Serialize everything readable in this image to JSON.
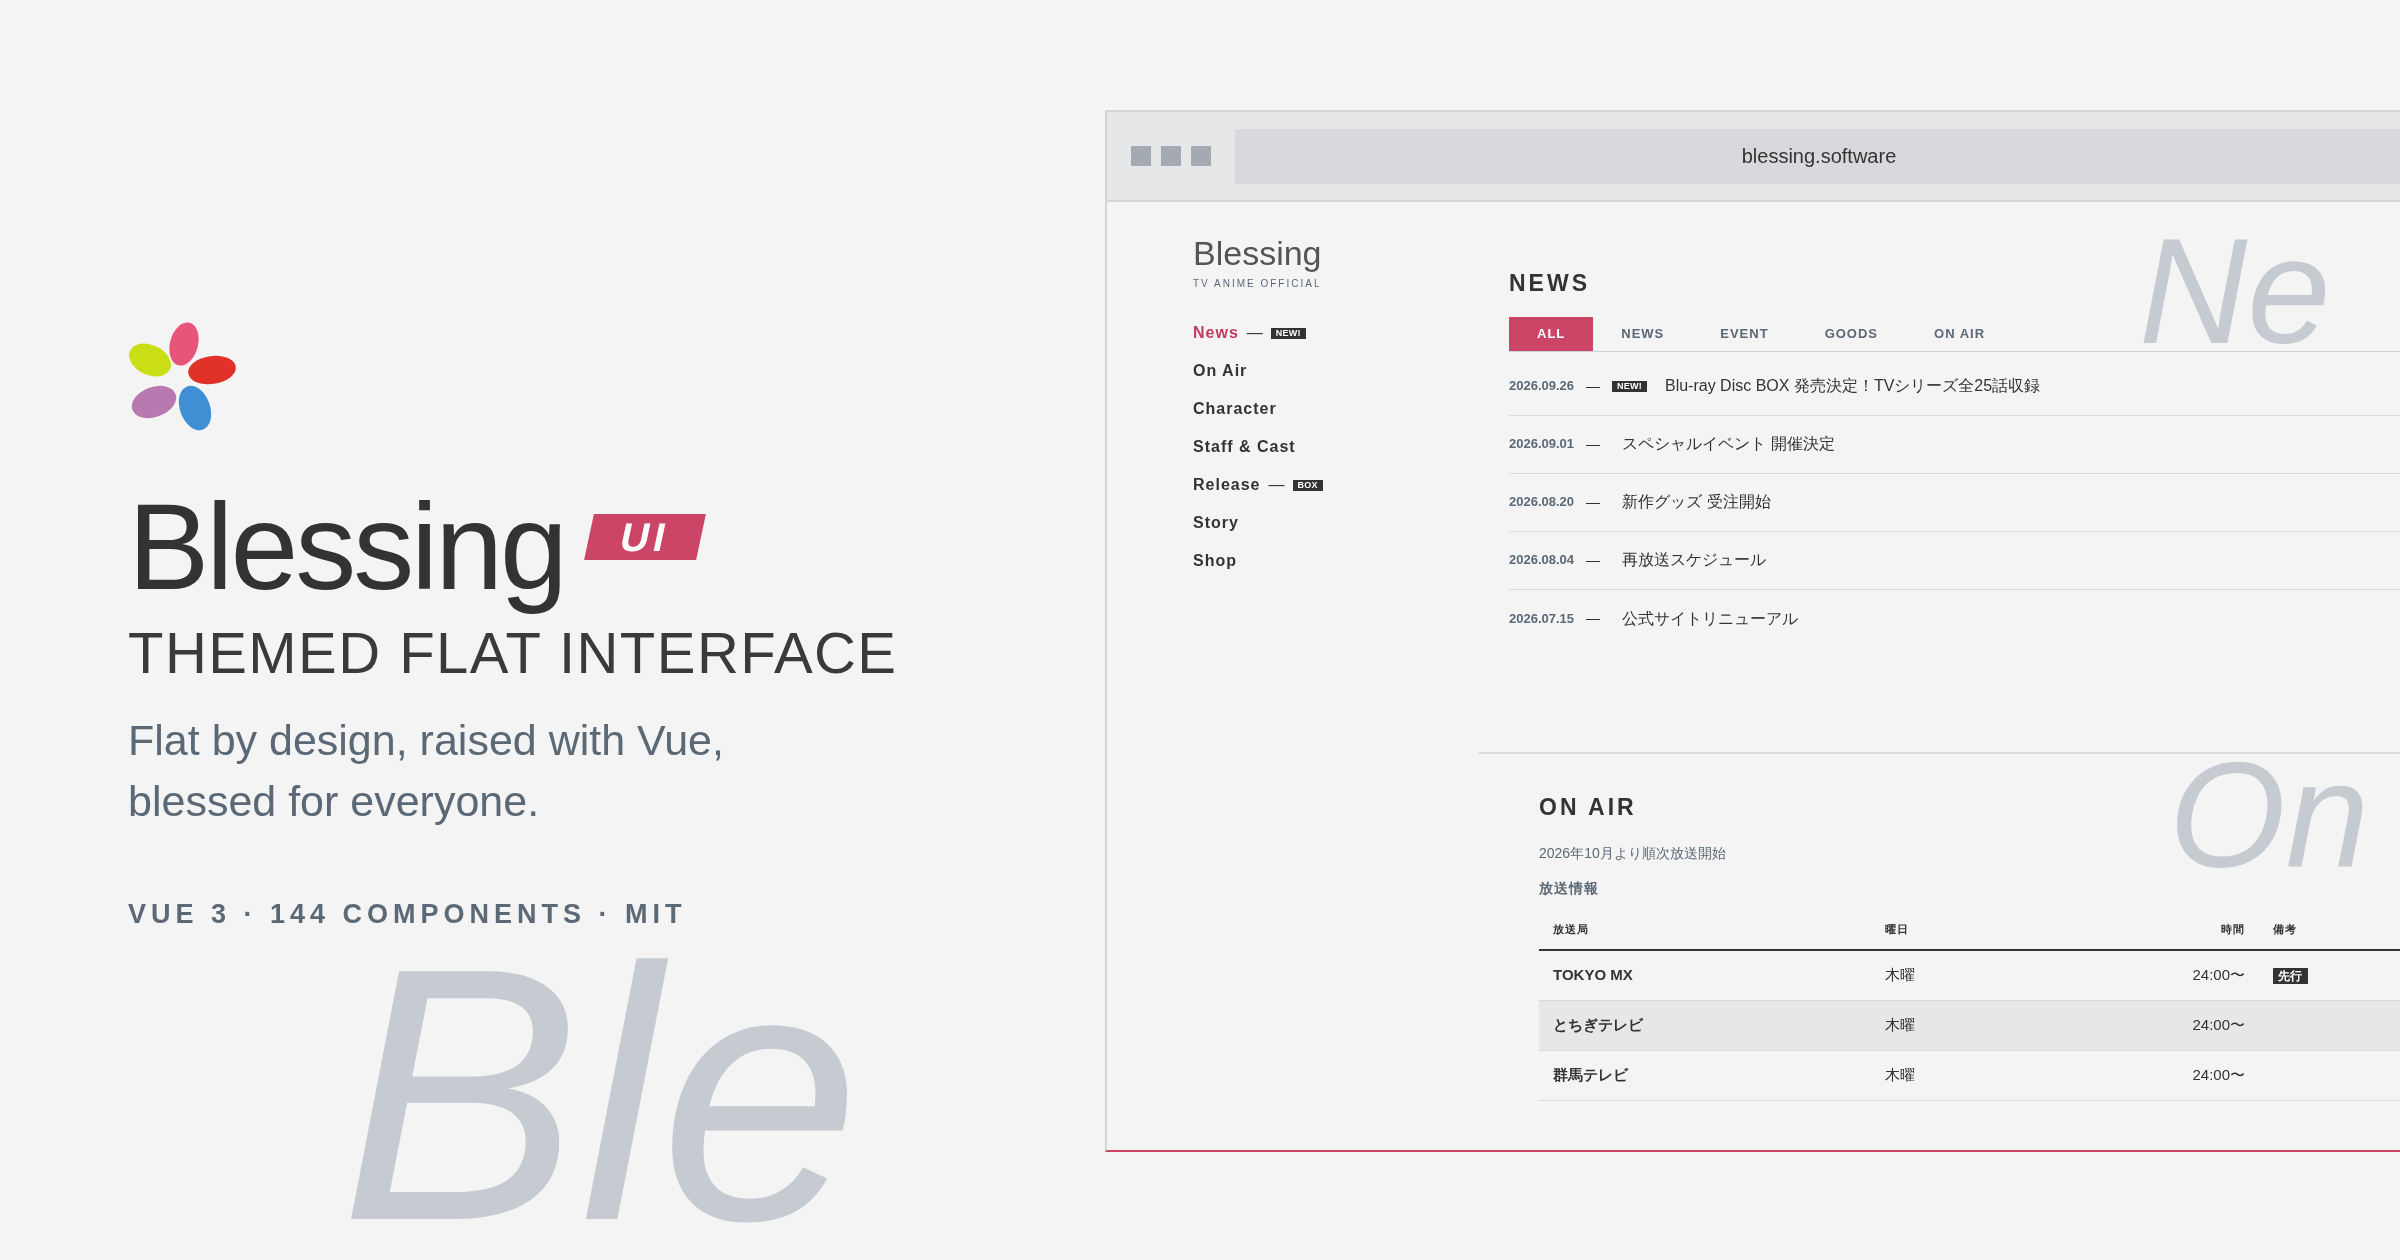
{
  "background_word": "Ble",
  "hero": {
    "title": "Blessing",
    "badge": "UI",
    "subtitle": "THEMED FLAT INTERFACE",
    "tagline": "Flat by design, raised with Vue, blessed for everyone.",
    "meta": "VUE 3 · 144 COMPONENTS · MIT"
  },
  "browser": {
    "address": "blessing.software",
    "site": {
      "logo": "Blessing",
      "logo_sub": "TV ANIME OFFICIAL",
      "nav": [
        {
          "label": "News",
          "selected": true,
          "dash": "—",
          "tag": "NEW!"
        },
        {
          "label": "On Air",
          "selected": false
        },
        {
          "label": "Character",
          "selected": false
        },
        {
          "label": "Staff & Cast",
          "selected": false
        },
        {
          "label": "Release",
          "selected": false,
          "dash": "—",
          "tag": "BOX"
        },
        {
          "label": "Story",
          "selected": false
        },
        {
          "label": "Shop",
          "selected": false
        }
      ],
      "news": {
        "title": "NEWS",
        "watermark": "Ne",
        "tabs": [
          {
            "label": "ALL",
            "selected": true
          },
          {
            "label": "NEWS",
            "selected": false
          },
          {
            "label": "EVENT",
            "selected": false
          },
          {
            "label": "GOODS",
            "selected": false
          },
          {
            "label": "ON AIR",
            "selected": false
          }
        ],
        "items": [
          {
            "date": "2026.09.26",
            "dash": "—",
            "tag": "NEW!",
            "title": "Blu-ray Disc BOX 発売決定！TVシリーズ全25話収録"
          },
          {
            "date": "2026.09.01",
            "dash": "—",
            "title": "スペシャルイベント 開催決定"
          },
          {
            "date": "2026.08.20",
            "dash": "—",
            "title": "新作グッズ 受注開始"
          },
          {
            "date": "2026.08.04",
            "dash": "—",
            "title": "再放送スケジュール"
          },
          {
            "date": "2026.07.15",
            "dash": "—",
            "title": "公式サイトリニューアル"
          }
        ]
      },
      "on_air": {
        "title": "ON AIR",
        "watermark": "On",
        "note": "2026年10月より順次放送開始",
        "table_title": "放送情報",
        "columns": [
          "放送局",
          "曜日",
          "時間",
          "備考"
        ],
        "rows": [
          {
            "station": "TOKYO MX",
            "day": "木曜",
            "time": "24:00〜",
            "remark": "先行",
            "highlighted": false
          },
          {
            "station": "とちぎテレビ",
            "day": "木曜",
            "time": "24:00〜",
            "highlighted": true
          },
          {
            "station": "群馬テレビ",
            "day": "木曜",
            "time": "24:00〜",
            "highlighted": false
          }
        ]
      }
    }
  }
}
